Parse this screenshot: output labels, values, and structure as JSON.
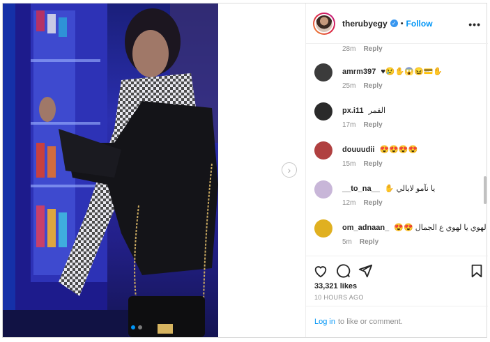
{
  "header": {
    "username": "therubyegy",
    "separator": "•",
    "follow_label": "Follow",
    "more_label": "•••"
  },
  "carousel": {
    "next_label": "›",
    "slide_count": 2,
    "active_slide": 1
  },
  "comments": {
    "first_meta": {
      "time": "28m",
      "reply": "Reply"
    },
    "items": [
      {
        "user": "amrm397",
        "text": "♥😢✋😱😖💳✋",
        "time": "25m",
        "reply": "Reply",
        "avatar_color": "#3b3b3b"
      },
      {
        "user": "px.i11",
        "text": "القمر",
        "time": "17m",
        "reply": "Reply",
        "avatar_color": "#2a2a2a"
      },
      {
        "user": "douuudii",
        "text": "😍😍😍😍",
        "time": "15m",
        "reply": "Reply",
        "avatar_color": "#b04040"
      },
      {
        "user": "__to_na__",
        "text": "✋ يا نآمو لايالي",
        "time": "12m",
        "reply": "Reply",
        "avatar_color": "#c8b6d8"
      },
      {
        "user": "om_adnaan_",
        "text": "😍😍 يا لهوي يا لهوي ع الجمال",
        "time": "5m",
        "reply": "Reply",
        "avatar_color": "#e0b020"
      }
    ]
  },
  "actions": {
    "icons": [
      "heart-icon",
      "comment-icon",
      "share-icon",
      "bookmark-icon"
    ],
    "likes": "33,321 likes",
    "timestamp": "10 HOURS AGO"
  },
  "footer": {
    "login_link": "Log in",
    "login_text": "to like or comment."
  },
  "colors": {
    "accent": "#0095f6",
    "muted": "#8e8e8e",
    "border": "#dbdbdb"
  }
}
